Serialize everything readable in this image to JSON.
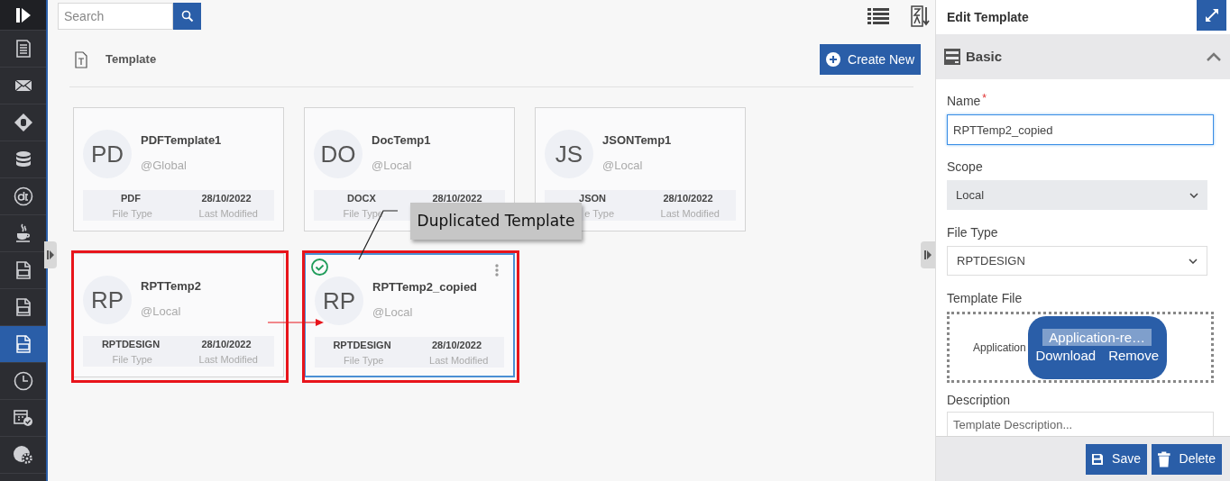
{
  "sidebar": {
    "items": [
      {
        "kind": "logo"
      },
      {
        "kind": "document",
        "selected": false
      },
      {
        "kind": "mail",
        "selected": false
      },
      {
        "kind": "diamond",
        "selected": false
      },
      {
        "kind": "database",
        "selected": false
      },
      {
        "kind": "circle",
        "selected": false
      },
      {
        "kind": "cup",
        "selected": false
      },
      {
        "kind": "file",
        "selected": false
      },
      {
        "kind": "file",
        "selected": false
      },
      {
        "kind": "file",
        "selected": true
      },
      {
        "kind": "clock",
        "selected": false
      },
      {
        "kind": "calendar",
        "selected": false
      },
      {
        "kind": "gear",
        "selected": false
      }
    ]
  },
  "toolbar": {
    "search": {
      "placeholder": "Search"
    }
  },
  "header": {
    "title": "Template",
    "create_button": "Create New"
  },
  "cards": [
    {
      "initials": "PD",
      "name": "PDFTemplate1",
      "scope": "@Global",
      "file_type": "PDF",
      "file_type_label": "File Type",
      "date": "28/10/2022",
      "date_label": "Last Modified",
      "selected": false,
      "highlighted": false
    },
    {
      "initials": "DO",
      "name": "DocTemp1",
      "scope": "@Local",
      "file_type": "DOCX",
      "file_type_label": "File Type",
      "date": "28/10/2022",
      "selected": false,
      "highlighted": false
    },
    {
      "initials": "JS",
      "name": "JSONTemp1",
      "scope": "@Local",
      "file_type": "JSON",
      "file_type_label": "e Type",
      "date": "28/10/2022",
      "date_label": "Last Modified",
      "selected": false,
      "highlighted": false
    },
    {
      "initials": "RP",
      "name": "RPTTemp2",
      "scope": "@Local",
      "file_type": "RPTDESIGN",
      "file_type_label": "File Type",
      "date": "28/10/2022",
      "date_label": "Last Modified",
      "selected": false,
      "highlighted": true
    },
    {
      "initials": "RP",
      "name": "RPTTemp2_copied",
      "scope": "@Local",
      "file_type": "RPTDESIGN",
      "file_type_label": "File Type",
      "date": "28/10/2022",
      "date_label": "Last Modified",
      "selected": true,
      "highlighted": true
    }
  ],
  "callout": {
    "text": "Duplicated Template"
  },
  "edit_panel": {
    "title": "Edit Template",
    "section": {
      "title": "Basic",
      "expanded": true
    },
    "name": {
      "label": "Name",
      "required_mark": "*",
      "value": "RPTTemp2_copied"
    },
    "scope": {
      "label": "Scope",
      "value": "Local"
    },
    "file_type": {
      "label": "File Type",
      "value": "RPTDESIGN"
    },
    "template_file": {
      "label": "Template File",
      "file_label": "Application",
      "chip": "Application-re…",
      "download": "Download",
      "remove": "Remove"
    },
    "description": {
      "label": "Description",
      "placeholder": "Template Description..."
    },
    "buttons": [
      "Save",
      "Delete"
    ]
  }
}
